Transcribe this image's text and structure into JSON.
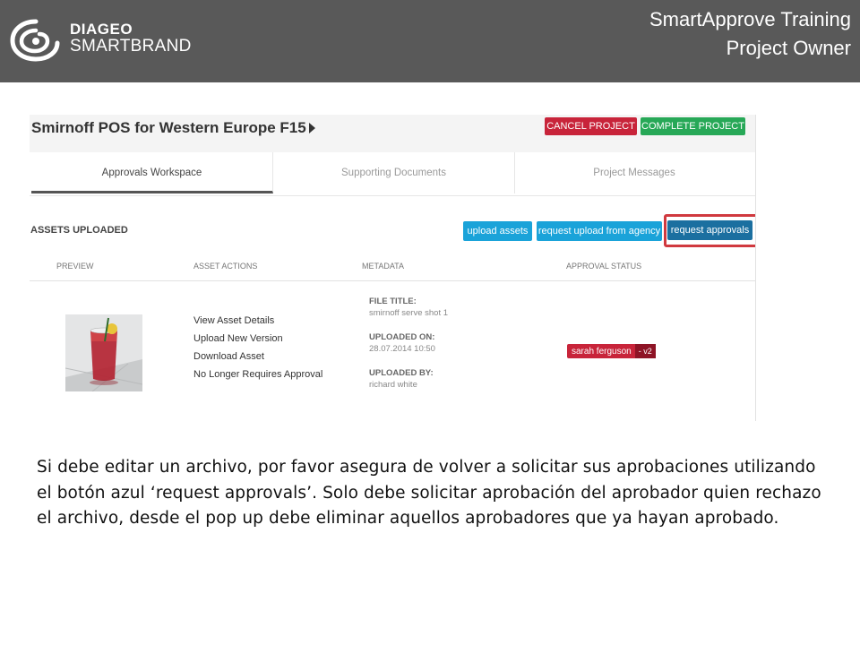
{
  "header": {
    "brand": "DIAGEO",
    "brand_sub": "SMARTBRAND",
    "title_line1": "SmartApprove Training",
    "title_line2": "Project Owner"
  },
  "project": {
    "title": "Smirnoff POS for Western Europe F15",
    "cancel_label": "CANCEL PROJECT",
    "complete_label": "COMPLETE PROJECT"
  },
  "tabs": [
    {
      "label": "Approvals Workspace",
      "active": true
    },
    {
      "label": "Supporting Documents",
      "active": false
    },
    {
      "label": "Project Messages",
      "active": false
    }
  ],
  "assets": {
    "section_title": "ASSETS UPLOADED",
    "upload_label": "upload assets",
    "request_agency_label": "request upload from agency",
    "request_approvals_label": "request approvals",
    "columns": [
      "PREVIEW",
      "ASSET ACTIONS",
      "METADATA",
      "APPROVAL STATUS"
    ],
    "row": {
      "actions": [
        "View Asset Details",
        "Upload New Version",
        "Download Asset",
        "No Longer Requires Approval"
      ],
      "file_title_label": "FILE TITLE:",
      "file_title": "smirnoff serve shot 1",
      "uploaded_on_label": "UPLOADED ON:",
      "uploaded_on": "28.07.2014 10:50",
      "uploaded_by_label": "UPLOADED BY:",
      "uploaded_by": "richard white",
      "approver": "sarah ferguson",
      "version": "- v2"
    }
  },
  "instructions": "Si debe editar un archivo, por favor asegura de volver a solicitar sus aprobaciones utilizando el botón azul ‘request approvals’.  Solo debe solicitar aprobación del aprobador quien rechazo el archivo, desde el pop up debe eliminar aquellos aprobadores que ya hayan aprobado.",
  "colors": {
    "header_bg": "#595959",
    "cancel": "#c8243a",
    "complete": "#27a857",
    "blue": "#1aa3d9",
    "highlight": "#d0393f"
  }
}
